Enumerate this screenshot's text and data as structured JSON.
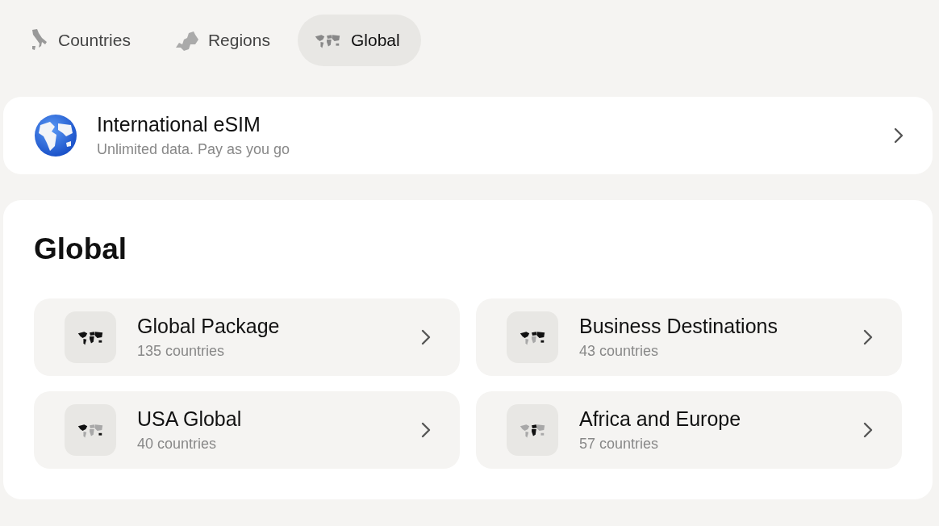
{
  "tabs": [
    {
      "label": "Countries",
      "kind": "country",
      "selected": false
    },
    {
      "label": "Regions",
      "kind": "region",
      "selected": false
    },
    {
      "label": "Global",
      "kind": "global",
      "selected": true
    }
  ],
  "banner": {
    "title": "International eSIM",
    "subtitle": "Unlimited data. Pay as you go"
  },
  "section": {
    "title": "Global",
    "packages": [
      {
        "name": "Global Package",
        "count": "135 countries"
      },
      {
        "name": "Business Destinations",
        "count": "43 countries"
      },
      {
        "name": "USA Global",
        "count": "40 countries"
      },
      {
        "name": "Africa and Europe",
        "count": "57 countries"
      }
    ]
  }
}
